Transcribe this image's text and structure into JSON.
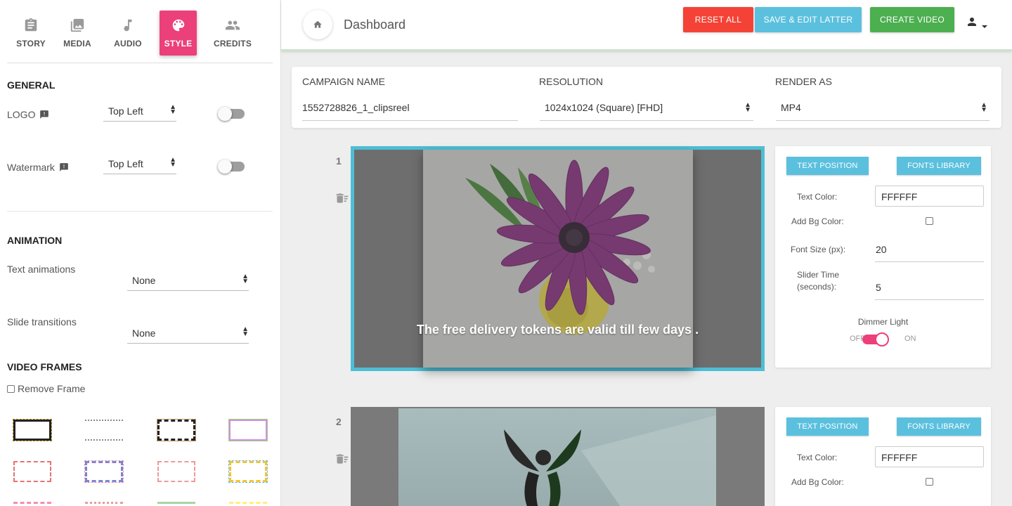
{
  "sidebar": {
    "tabs": [
      {
        "label": "STORY",
        "icon": "clipboard-icon"
      },
      {
        "label": "MEDIA",
        "icon": "image-icon"
      },
      {
        "label": "AUDIO",
        "icon": "music-note-icon"
      },
      {
        "label": "STYLE",
        "icon": "palette-icon",
        "active": true
      },
      {
        "label": "CREDITS",
        "icon": "people-icon"
      }
    ],
    "general": {
      "title": "GENERAL",
      "logo_label": "LOGO",
      "logo_position": "Top Left",
      "logo_enabled": false,
      "watermark_label": "Watermark",
      "watermark_position": "Top Left",
      "watermark_enabled": false
    },
    "animation": {
      "title": "ANIMATION",
      "text_animations_label": "Text animations",
      "text_animations_value": "None",
      "slide_transitions_label": "Slide transitions",
      "slide_transitions_value": "None"
    },
    "video_frames": {
      "title": "VIDEO FRAMES",
      "remove_frame_label": "Remove Frame",
      "remove_frame_checked": false
    }
  },
  "header": {
    "title": "Dashboard",
    "reset_label": "RESET ALL",
    "save_label": "SAVE & EDIT LATTER",
    "create_label": "CREATE VIDEO",
    "colors": {
      "reset": "#f44336",
      "save": "#5bc0de",
      "create": "#4caf50"
    }
  },
  "campaign": {
    "name_label": "CAMPAIGN NAME",
    "name_value": "1552728826_1_clipsreel",
    "resolution_label": "RESOLUTION",
    "resolution_value": "1024x1024 (Square) [FHD]",
    "render_label": "RENDER AS",
    "render_value": "MP4"
  },
  "slides": [
    {
      "number": "1",
      "caption": "The free delivery tokens are valid till few days .",
      "text_position_label": "TEXT POSITION",
      "fonts_library_label": "FONTS LIBRARY",
      "text_color_label": "Text Color:",
      "text_color_value": "FFFFFF",
      "add_bg_label": "Add Bg Color:",
      "font_size_label": "Font Size (px):",
      "font_size_value": "20",
      "slider_time_label_1": "Slider Time",
      "slider_time_label_2": "(seconds):",
      "slider_time_value": "5",
      "dimmer_label": "Dimmer Light",
      "dimmer_off": "OFF",
      "dimmer_on": "ON",
      "dimmer_enabled": true
    },
    {
      "number": "2",
      "text_position_label": "TEXT POSITION",
      "fonts_library_label": "FONTS LIBRARY",
      "text_color_label": "Text Color:",
      "text_color_value": "FFFFFF",
      "add_bg_label": "Add Bg Color:"
    }
  ]
}
